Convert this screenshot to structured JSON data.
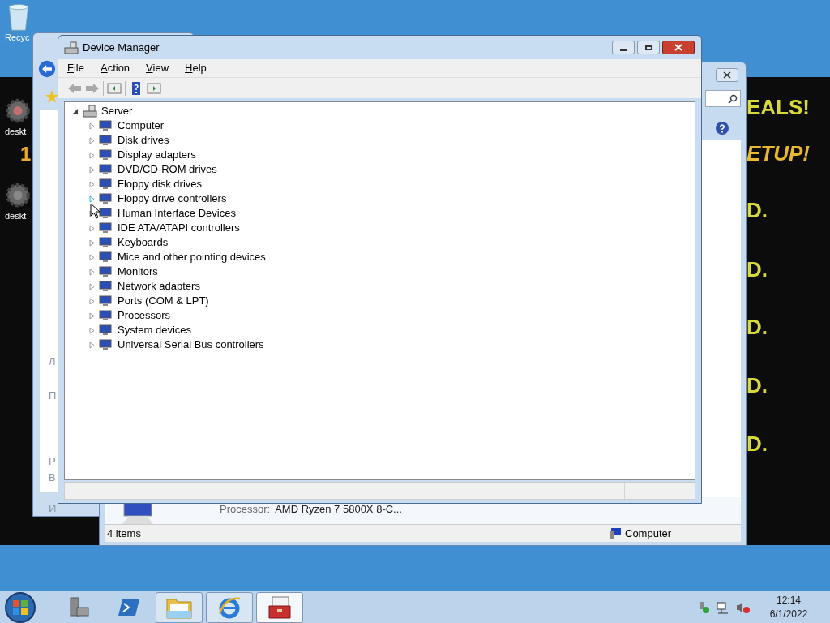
{
  "desktop": {
    "icons": [
      {
        "label": "Recyc",
        "kind": "bin"
      },
      {
        "label": "deskt",
        "kind": "gear"
      },
      {
        "label": "deskt",
        "kind": "gear"
      }
    ],
    "wallpaper_digit": "1",
    "wallpaper_text": [
      {
        "text": "EALS!",
        "kind": "headline"
      },
      {
        "text": "ETUP!",
        "kind": "subline"
      },
      {
        "text": "D.",
        "kind": "line"
      },
      {
        "text": "D.",
        "kind": "line"
      },
      {
        "text": "D.",
        "kind": "line"
      },
      {
        "text": "D.",
        "kind": "line"
      },
      {
        "text": "D.",
        "kind": "line"
      }
    ]
  },
  "browser_window": {
    "fragments": [
      "Л",
      "П",
      "Р",
      "В",
      "И"
    ]
  },
  "explorer_window": {
    "details": [
      {
        "label": "Processor:",
        "value": "AMD Ryzen 7 5800X 8-C..."
      }
    ],
    "status_bar": {
      "count": "4 items",
      "location": "Computer"
    }
  },
  "device_manager": {
    "title": "Device Manager",
    "menu": [
      "File",
      "Action",
      "View",
      "Help"
    ],
    "toolbar": [
      {
        "kind": "back",
        "disabled": true
      },
      {
        "kind": "forward",
        "disabled": true
      },
      {
        "kind": "console",
        "disabled": false
      },
      {
        "kind": "help",
        "disabled": false
      },
      {
        "kind": "pane",
        "disabled": false
      }
    ],
    "tree": {
      "label": "Server",
      "expanded": true,
      "children": [
        {
          "label": "Computer",
          "expanded": false,
          "hovered": false
        },
        {
          "label": "Disk drives",
          "expanded": false,
          "hovered": false
        },
        {
          "label": "Display adapters",
          "expanded": false,
          "hovered": false
        },
        {
          "label": "DVD/CD-ROM drives",
          "expanded": false,
          "hovered": false
        },
        {
          "label": "Floppy disk drives",
          "expanded": false,
          "hovered": false
        },
        {
          "label": "Floppy drive controllers",
          "expanded": false,
          "hovered": true
        },
        {
          "label": "Human Interface Devices",
          "expanded": false,
          "hovered": false
        },
        {
          "label": "IDE ATA/ATAPI controllers",
          "expanded": false,
          "hovered": false
        },
        {
          "label": "Keyboards",
          "expanded": false,
          "hovered": false
        },
        {
          "label": "Mice and other pointing devices",
          "expanded": false,
          "hovered": false
        },
        {
          "label": "Monitors",
          "expanded": false,
          "hovered": false
        },
        {
          "label": "Network adapters",
          "expanded": false,
          "hovered": false
        },
        {
          "label": "Ports (COM & LPT)",
          "expanded": false,
          "hovered": false
        },
        {
          "label": "Processors",
          "expanded": false,
          "hovered": false
        },
        {
          "label": "System devices",
          "expanded": false,
          "hovered": false
        },
        {
          "label": "Universal Serial Bus controllers",
          "expanded": false,
          "hovered": false
        }
      ]
    }
  },
  "taskbar": {
    "items": [
      {
        "kind": "server",
        "running": false,
        "selected": false
      },
      {
        "kind": "shell",
        "running": false,
        "selected": false
      },
      {
        "kind": "folder",
        "running": true,
        "selected": false
      },
      {
        "kind": "browser",
        "running": true,
        "selected": false
      },
      {
        "kind": "toolbox",
        "running": true,
        "selected": true
      }
    ],
    "clock": {
      "time": "12:14",
      "date": "6/1/2022"
    }
  }
}
